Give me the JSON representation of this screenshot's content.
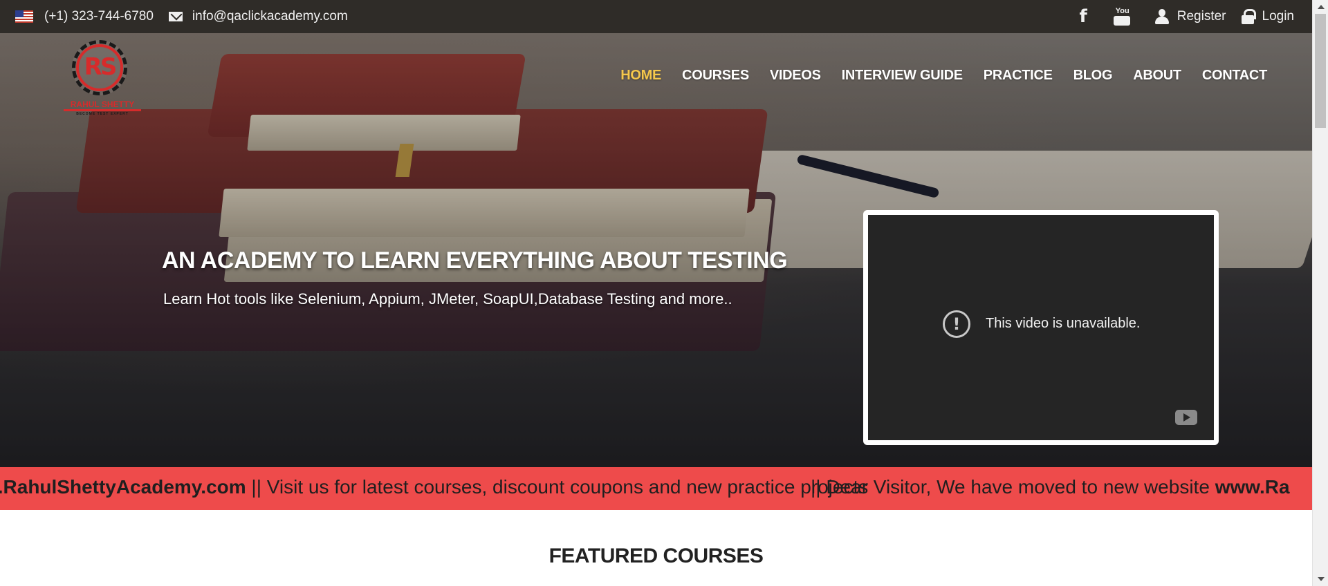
{
  "topbar": {
    "phone": "(+1) 323-744-6780",
    "email": "info@qaclickacademy.com",
    "register_label": "Register",
    "login_label": "Login",
    "icons": [
      "us-flag-icon",
      "envelope-icon",
      "facebook-icon",
      "youtube-icon",
      "user-icon",
      "lock-icon"
    ]
  },
  "logo": {
    "mark": "RS",
    "name": "RAHUL SHETTY",
    "tagline": "BECOME TEST EXPERT"
  },
  "nav": {
    "items": [
      {
        "label": "HOME",
        "active": true
      },
      {
        "label": "COURSES",
        "active": false
      },
      {
        "label": "VIDEOS",
        "active": false
      },
      {
        "label": "INTERVIEW GUIDE",
        "active": false
      },
      {
        "label": "PRACTICE",
        "active": false
      },
      {
        "label": "BLOG",
        "active": false
      },
      {
        "label": "ABOUT",
        "active": false
      },
      {
        "label": "CONTACT",
        "active": false
      }
    ]
  },
  "hero": {
    "title": "AN ACADEMY TO LEARN EVERYTHING ABOUT TESTING",
    "subtitle": "Learn Hot tools like Selenium, Appium, JMeter, SoapUI,Database Testing and more.."
  },
  "video": {
    "message": "This video is unavailable."
  },
  "marquee": {
    "segment_a_bold": "w.RahulShettyAcademy.com",
    "segment_a_text": " || Visit us for latest courses, discount coupons and new practice projects",
    "segment_b_text": "|| Dear Visitor, We have moved to new website ",
    "segment_b_bold": "www.Ra"
  },
  "featured": {
    "title": "FEATURED COURSES"
  },
  "colors": {
    "topbar_bg": "#2f2c28",
    "nav_active": "#f5c84c",
    "marquee_bg": "#ee4b4b",
    "brand_red": "#d62b2b"
  }
}
